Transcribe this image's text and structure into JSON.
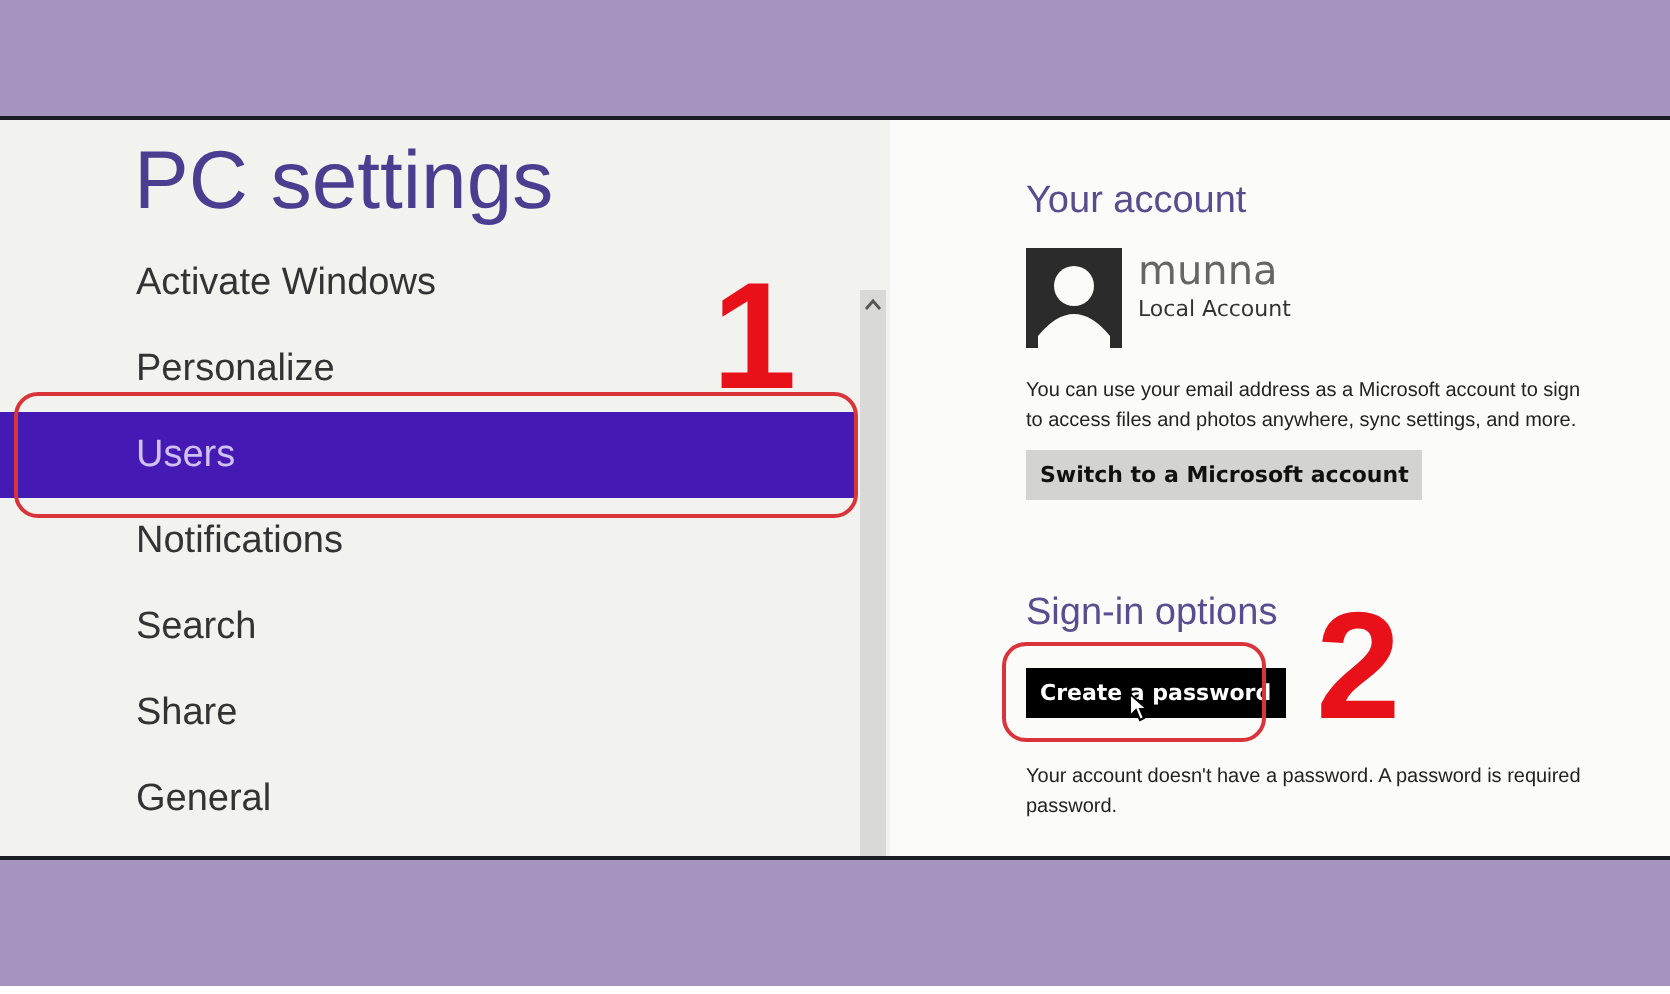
{
  "left_pane": {
    "title": "PC settings",
    "items": [
      {
        "label": "Activate Windows",
        "selected": false
      },
      {
        "label": "Personalize",
        "selected": false
      },
      {
        "label": "Users",
        "selected": true
      },
      {
        "label": "Notifications",
        "selected": false
      },
      {
        "label": "Search",
        "selected": false
      },
      {
        "label": "Share",
        "selected": false
      },
      {
        "label": "General",
        "selected": false
      }
    ]
  },
  "right_pane": {
    "account_heading": "Your account",
    "user_name": "munna",
    "account_type": "Local Account",
    "account_text": [
      "You can use your email address as a Microsoft account to sign",
      "to access files and photos anywhere, sync settings, and more."
    ],
    "switch_button": "Switch to a Microsoft account",
    "signin_heading": "Sign-in options",
    "create_button": "Create a password",
    "password_text": [
      "Your account doesn't have a password. A password is required",
      "password."
    ]
  },
  "annotations": [
    {
      "label": "1"
    },
    {
      "label": "2"
    }
  ]
}
